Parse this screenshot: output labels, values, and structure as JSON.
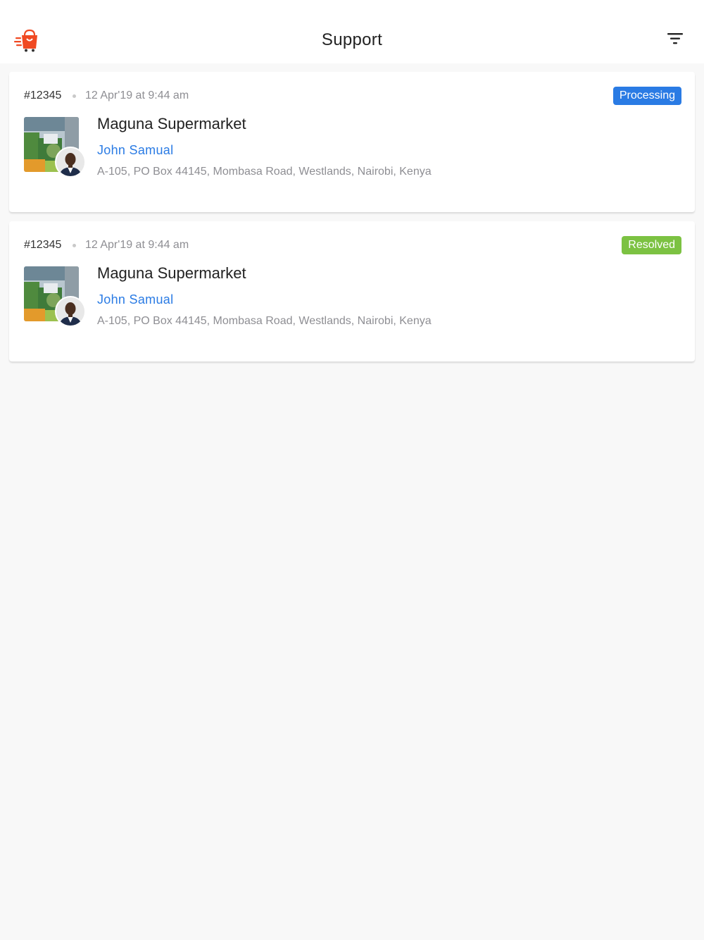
{
  "header": {
    "title": "Support",
    "logo_icon": "shopping-bag-logo-icon",
    "filter_icon": "filter-icon",
    "brand_color": "#f04a23"
  },
  "tickets": [
    {
      "order_id": "#12345",
      "date": "12 Apr'19 at 9:44 am",
      "status": "Processing",
      "status_color": "#2a7be4",
      "store_name": "Maguna Supermarket",
      "customer_name": "John Samual",
      "address": "A-105, PO Box 44145, Mombasa Road, Westlands, Nairobi, Kenya"
    },
    {
      "order_id": "#12345",
      "date": "12 Apr'19 at 9:44 am",
      "status": "Resolved",
      "status_color": "#7cc242",
      "store_name": "Maguna Supermarket",
      "customer_name": "John Samual",
      "address": "A-105, PO Box 44145, Mombasa Road, Westlands, Nairobi, Kenya"
    }
  ]
}
